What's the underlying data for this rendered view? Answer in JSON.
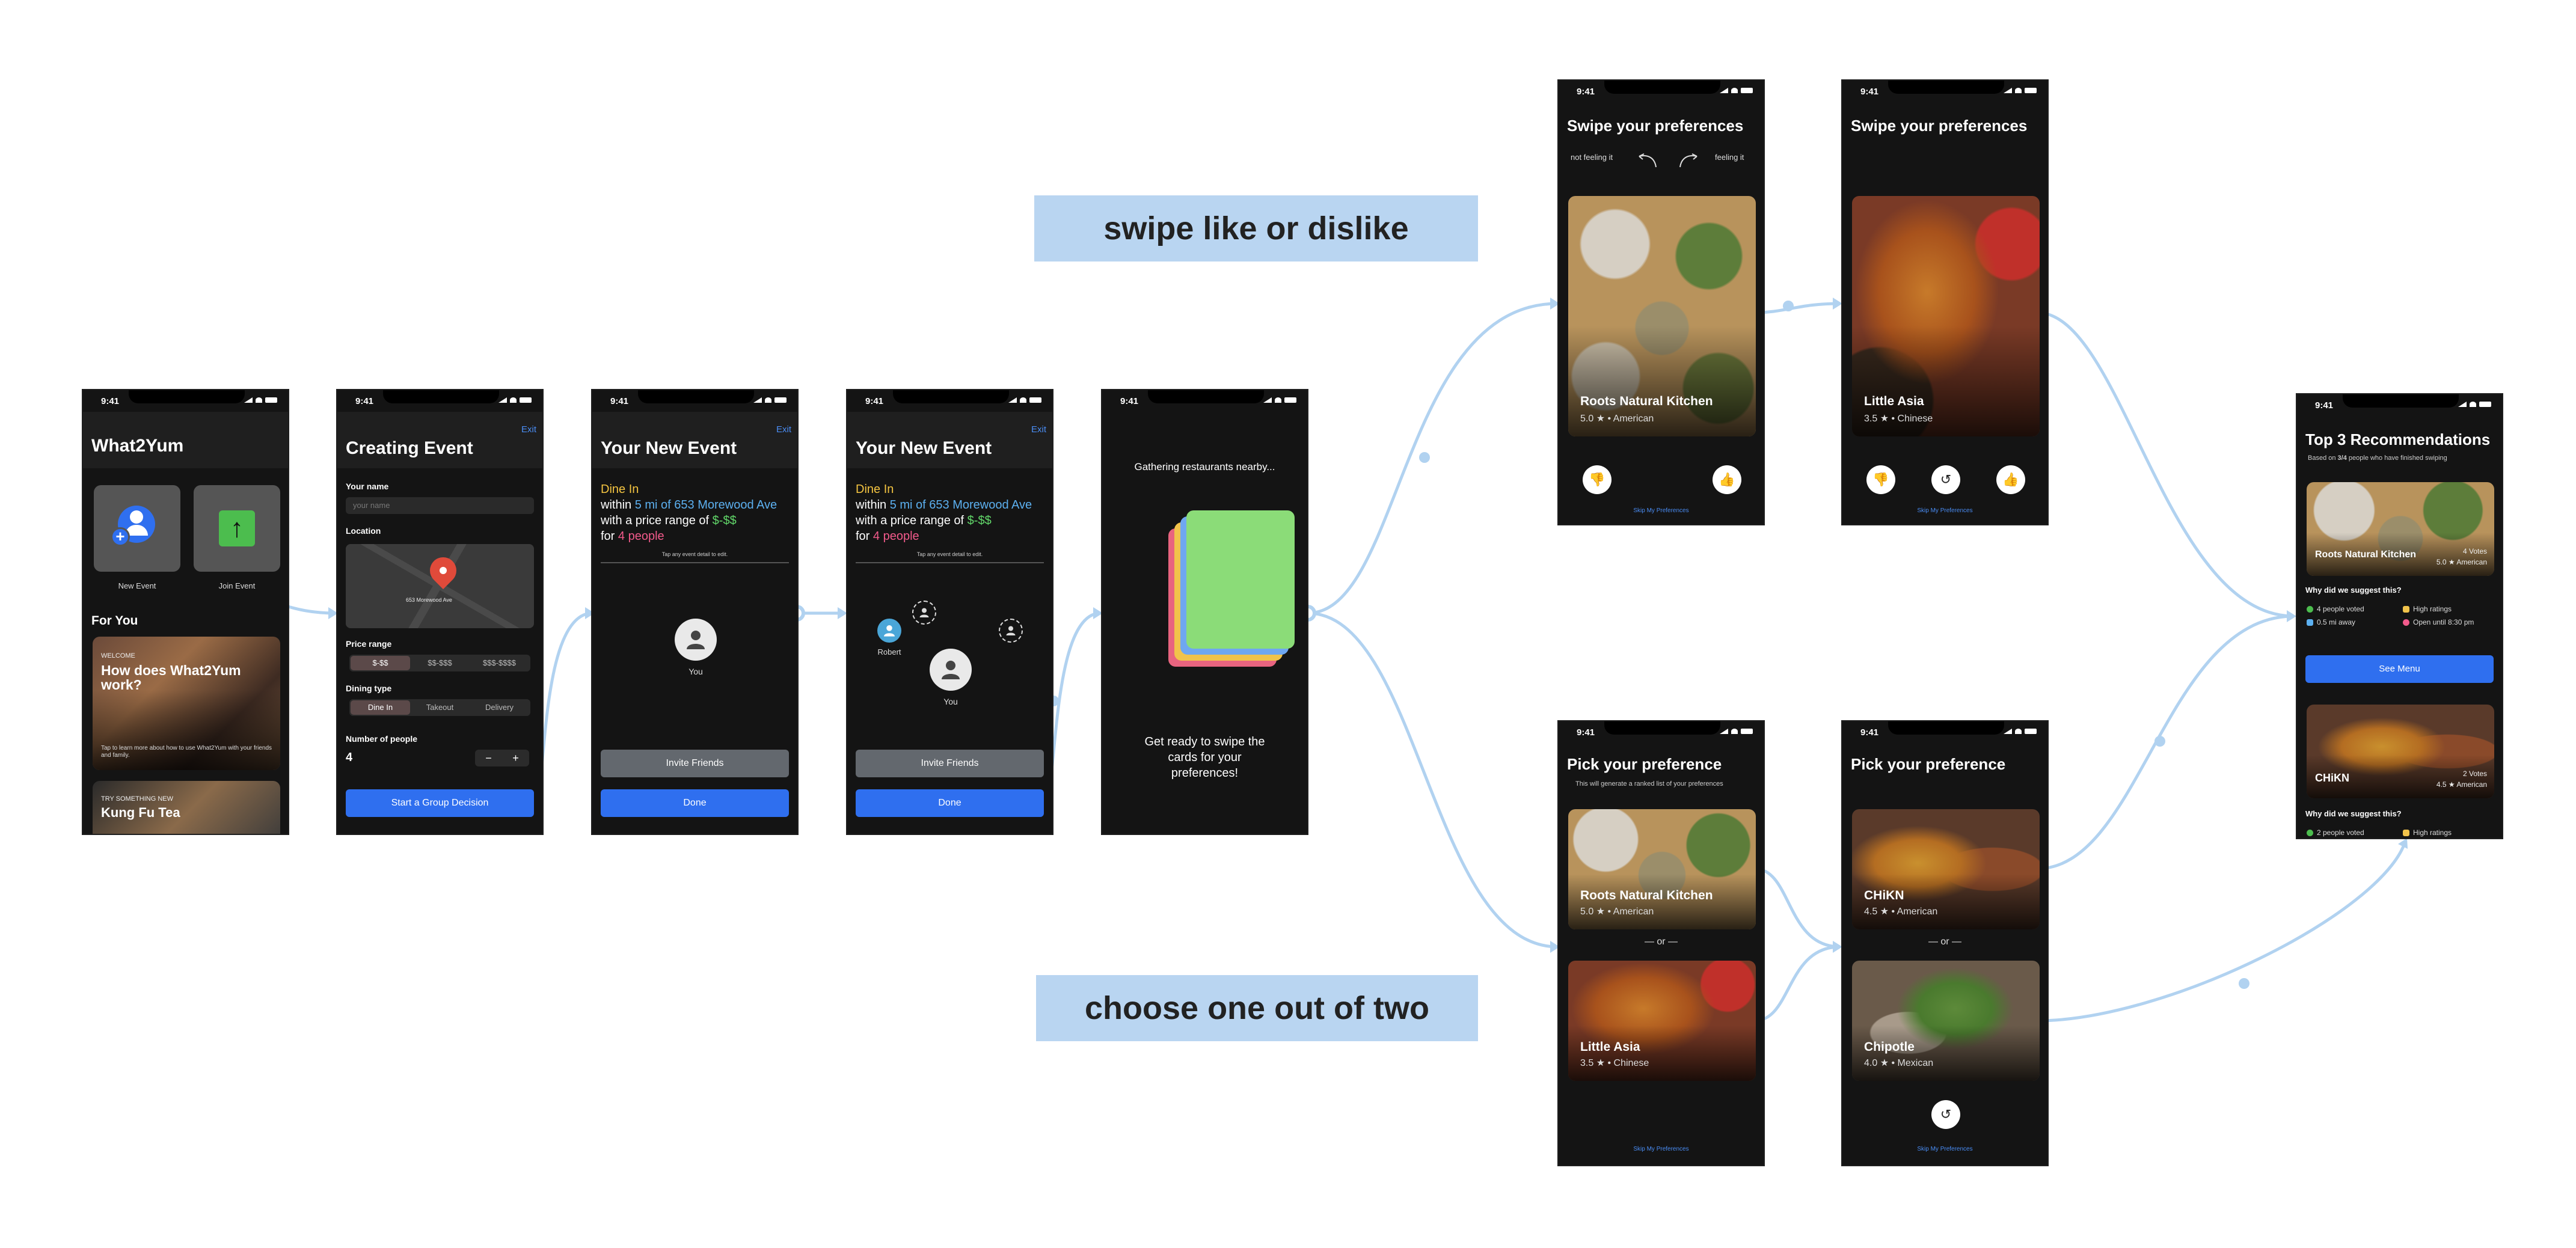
{
  "status_time": "9:41",
  "banners": {
    "swipe": "swipe like or dislike",
    "choose": "choose one out of two"
  },
  "home": {
    "title": "What2Yum",
    "new_event": "New Event",
    "join_event": "Join Event",
    "for_you": "For You",
    "card1_tag": "WELCOME",
    "card1_title": "How does What2Yum work?",
    "card1_desc": "Tap to learn more about how to use What2Yum with your friends and family.",
    "card2_tag": "TRY SOMETHING NEW",
    "card2_title": "Kung Fu Tea"
  },
  "creating": {
    "exit": "Exit",
    "title": "Creating Event",
    "name_label": "Your name",
    "name_placeholder": "your name",
    "location_label": "Location",
    "map_pin_label": "653 Morewood Ave",
    "price_label": "Price range",
    "price_options": [
      "$-$$",
      "$$-$$$",
      "$$$-$$$$"
    ],
    "dining_label": "Dining type",
    "dining_options": [
      "Dine In",
      "Takeout",
      "Delivery"
    ],
    "people_label": "Number of people",
    "people_value": "4",
    "minus": "−",
    "plus": "+",
    "cta": "Start a Group Decision"
  },
  "event": {
    "exit": "Exit",
    "title": "Your New Event",
    "line1": "Dine In",
    "within": "within ",
    "distance": "5 mi of 653 Morewood Ave",
    "price_prefix": "with a price range of ",
    "price": "$-$$",
    "for": "for ",
    "people": "4 people",
    "hint": "Tap any event detail to edit.",
    "you": "You",
    "robert": "Robert",
    "invite": "Invite Friends",
    "done": "Done"
  },
  "gathering": {
    "top": "Gathering restaurants nearby...",
    "bottom": "Get ready to swipe the cards for your preferences!",
    "card_colors": [
      "#e8647f",
      "#f1c34b",
      "#6fa7f0",
      "#8bdc78"
    ]
  },
  "swipe": {
    "title": "Swipe your preferences",
    "not_feeling": "not feeling it",
    "feeling": "feeling it",
    "skip": "Skip My Preferences",
    "cards": [
      {
        "name": "Roots Natural Kitchen",
        "rating": "5.0",
        "cuisine": "American"
      },
      {
        "name": "Little Asia",
        "rating": "3.5",
        "cuisine": "Chinese"
      }
    ]
  },
  "pick": {
    "title": "Pick your preference",
    "subtitle": "This will generate a ranked list of your preferences",
    "or": "— or —",
    "skip": "Skip My Preferences",
    "screen1": [
      {
        "name": "Roots Natural Kitchen",
        "rating": "5.0",
        "cuisine": "American"
      },
      {
        "name": "Little Asia",
        "rating": "3.5",
        "cuisine": "Chinese"
      }
    ],
    "screen2": [
      {
        "name": "CHiKN",
        "rating": "4.5",
        "cuisine": "American"
      },
      {
        "name": "Chipotle",
        "rating": "4.0",
        "cuisine": "Mexican"
      }
    ]
  },
  "recs": {
    "title": "Top 3 Recommendations",
    "subtitle_pre": "Based on ",
    "subtitle_bold": "3/4",
    "subtitle_post": " people who have finished swiping",
    "why": "Why did we suggest this?",
    "see_menu": "See Menu",
    "items": [
      {
        "name": "Roots Natural Kitchen",
        "votes": "4 Votes",
        "rating": "5.0",
        "cuisine": "American"
      },
      {
        "name": "CHiKN",
        "votes": "2 Votes",
        "rating": "4.5",
        "cuisine": "American"
      }
    ],
    "reasons1": [
      "4 people voted",
      "High ratings",
      "0.5 mi away",
      "Open until 8:30 pm"
    ],
    "reasons2": [
      "2 people voted",
      "High ratings"
    ]
  },
  "colors": {
    "flow": "#b1d2f0",
    "accent_blue": "#2f6fef",
    "banner_bg": "#b9d5f1",
    "yellow": "#f5c541",
    "link_blue": "#5cb0f0",
    "green": "#62d86a",
    "pink": "#f25a8b"
  }
}
